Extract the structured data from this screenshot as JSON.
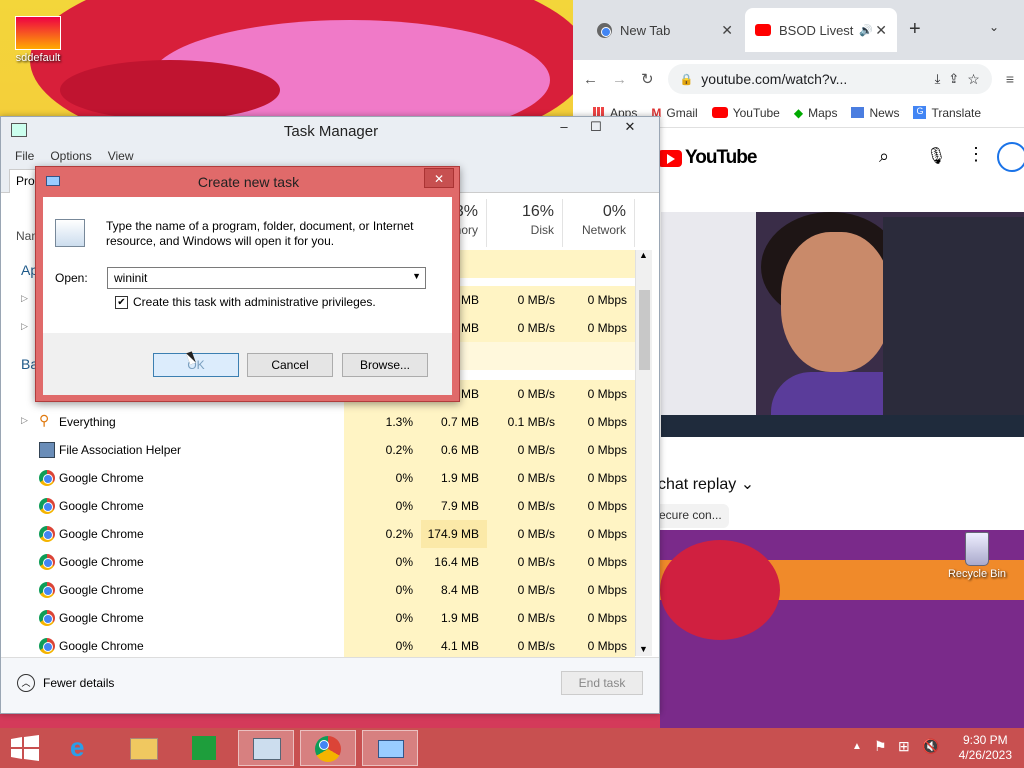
{
  "desktop": {
    "icons": [
      {
        "label": "sddefault"
      },
      {
        "label": "Recycle Bin"
      }
    ]
  },
  "chrome": {
    "tabs": [
      {
        "label": "New Tab"
      },
      {
        "label": "BSOD Livest"
      }
    ],
    "url": "youtube.com/watch?v...",
    "bookmarks": [
      "Apps",
      "Gmail",
      "YouTube",
      "Maps",
      "News",
      "Translate"
    ],
    "yt_logo": "YouTube",
    "chat_replay": "chat replay",
    "chip": "ecure con..."
  },
  "task_manager": {
    "title": "Task Manager",
    "menu": [
      "File",
      "Options",
      "View"
    ],
    "tab_partial": "Pro",
    "name_header_partial": "Nan",
    "section_apps_partial": "Ap",
    "section_bg_partial": "Ba",
    "columns": [
      {
        "pct": "3%",
        "label": "nory"
      },
      {
        "pct": "16%",
        "label": "Disk"
      },
      {
        "pct": "0%",
        "label": "Network"
      }
    ],
    "hidden_rows": [
      {
        "mem": "MB",
        "disk": "0 MB/s",
        "net": "0 Mbps"
      },
      {
        "mem": "MB",
        "disk": "0 MB/s",
        "net": "0 Mbps"
      },
      {
        "mem": "MB",
        "disk": "0 MB/s",
        "net": "0 Mbps"
      }
    ],
    "rows": [
      {
        "name": "Everything",
        "cpu": "1.3%",
        "mem": "0.7 MB",
        "disk": "0.1 MB/s",
        "net": "0 Mbps",
        "icon": "search-icon"
      },
      {
        "name": "File Association Helper",
        "cpu": "0.2%",
        "mem": "0.6 MB",
        "disk": "0 MB/s",
        "net": "0 Mbps",
        "icon": "app-icon"
      },
      {
        "name": "Google Chrome",
        "cpu": "0%",
        "mem": "1.9 MB",
        "disk": "0 MB/s",
        "net": "0 Mbps",
        "icon": "chrome-icon"
      },
      {
        "name": "Google Chrome",
        "cpu": "0%",
        "mem": "7.9 MB",
        "disk": "0 MB/s",
        "net": "0 Mbps",
        "icon": "chrome-icon"
      },
      {
        "name": "Google Chrome",
        "cpu": "0.2%",
        "mem": "174.9 MB",
        "disk": "0 MB/s",
        "net": "0 Mbps",
        "icon": "chrome-icon"
      },
      {
        "name": "Google Chrome",
        "cpu": "0%",
        "mem": "16.4 MB",
        "disk": "0 MB/s",
        "net": "0 Mbps",
        "icon": "chrome-icon"
      },
      {
        "name": "Google Chrome",
        "cpu": "0%",
        "mem": "8.4 MB",
        "disk": "0 MB/s",
        "net": "0 Mbps",
        "icon": "chrome-icon"
      },
      {
        "name": "Google Chrome",
        "cpu": "0%",
        "mem": "1.9 MB",
        "disk": "0 MB/s",
        "net": "0 Mbps",
        "icon": "chrome-icon"
      },
      {
        "name": "Google Chrome",
        "cpu": "0%",
        "mem": "4.1 MB",
        "disk": "0 MB/s",
        "net": "0 Mbps",
        "icon": "chrome-icon"
      }
    ],
    "fewer_details": "Fewer details",
    "end_task": "End task"
  },
  "dialog": {
    "title": "Create new task",
    "description": "Type the name of a program, folder, document, or Internet resource, and Windows will open it for you.",
    "open_label": "Open:",
    "open_value": "wininit",
    "admin_checkbox_label": "Create this task with administrative privileges.",
    "admin_checked": true,
    "ok_label": "OK",
    "cancel_label": "Cancel",
    "browse_label": "Browse..."
  },
  "taskbar": {
    "time": "9:30 PM",
    "date": "4/26/2023"
  }
}
